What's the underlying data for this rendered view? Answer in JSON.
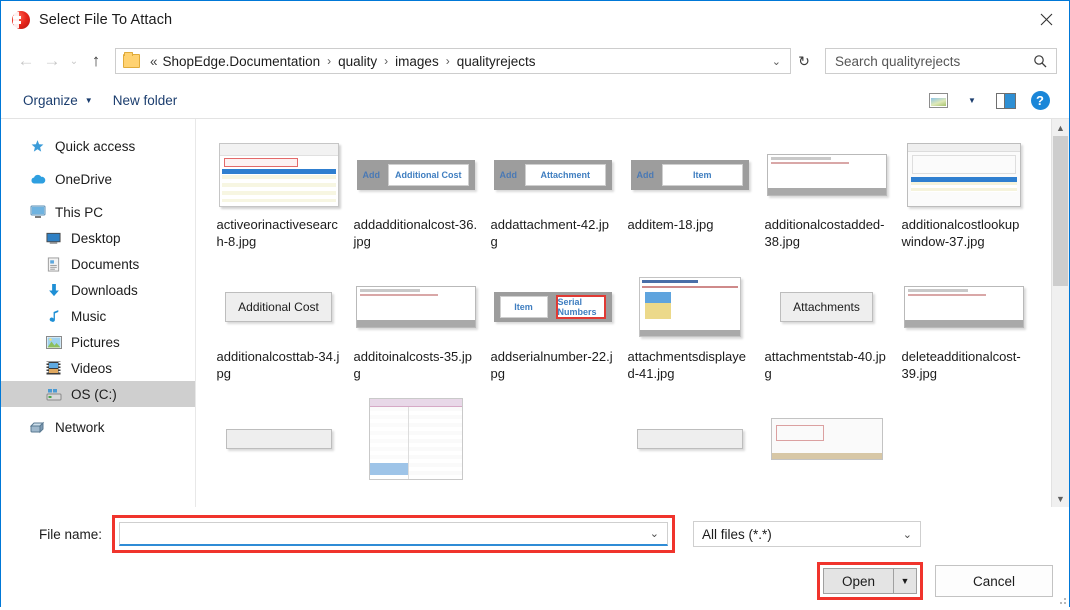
{
  "window": {
    "title": "Select File To Attach",
    "icon": "shopedge-logo-icon",
    "close_label": "✕",
    "accent": "#0078d7",
    "highlight_red": "#f0342c"
  },
  "nav": {
    "back": "←",
    "forward": "→",
    "recent": "⌄",
    "up": "↑",
    "refresh": "↻",
    "address_caret": "⌄",
    "breadcrumb_lead": "«",
    "breadcrumb": [
      "ShopEdge.Documentation",
      "quality",
      "images",
      "qualityrejects"
    ],
    "separator": "›"
  },
  "search": {
    "placeholder": "Search qualityrejects",
    "value": ""
  },
  "toolbar": {
    "organize_label": "Organize",
    "organize_caret": "▼",
    "new_folder_label": "New folder",
    "view_caret": "▼"
  },
  "sidebar": {
    "items": [
      {
        "label": "Quick access",
        "icon": "star-icon",
        "level": 0,
        "selected": false,
        "gap": false
      },
      {
        "label": "OneDrive",
        "icon": "cloud-icon",
        "level": 0,
        "selected": false,
        "gap": true
      },
      {
        "label": "This PC",
        "icon": "monitor-icon",
        "level": 0,
        "selected": false,
        "gap": true
      },
      {
        "label": "Desktop",
        "icon": "desktop-icon",
        "level": 1,
        "selected": false,
        "gap": false
      },
      {
        "label": "Documents",
        "icon": "document-icon",
        "level": 1,
        "selected": false,
        "gap": false
      },
      {
        "label": "Downloads",
        "icon": "download-icon",
        "level": 1,
        "selected": false,
        "gap": false
      },
      {
        "label": "Music",
        "icon": "music-note-icon",
        "level": 1,
        "selected": false,
        "gap": false
      },
      {
        "label": "Pictures",
        "icon": "picture-icon",
        "level": 1,
        "selected": false,
        "gap": false
      },
      {
        "label": "Videos",
        "icon": "video-icon",
        "level": 1,
        "selected": false,
        "gap": false
      },
      {
        "label": "OS (C:)",
        "icon": "drive-icon",
        "level": 1,
        "selected": true,
        "gap": false
      },
      {
        "label": "Network",
        "icon": "network-icon",
        "level": 0,
        "selected": false,
        "gap": true
      }
    ]
  },
  "files": [
    {
      "name": "activeorinactivesearch-8.jpg",
      "thumb": "screenshot-table"
    },
    {
      "name": "addadditionalcost-36.jpg",
      "thumb": "bar-add-additional-cost",
      "bar_left": "Add",
      "bar_box": "Additional Cost"
    },
    {
      "name": "addattachment-42.jpg",
      "thumb": "bar-add-attachment",
      "bar_left": "Add",
      "bar_box": "Attachment"
    },
    {
      "name": "additem-18.jpg",
      "thumb": "bar-add-item",
      "bar_left": "Add",
      "bar_box": "Item"
    },
    {
      "name": "additionalcostadded-38.jpg",
      "thumb": "window-blank"
    },
    {
      "name": "additionalcostlookupwindow-37.jpg",
      "thumb": "dialog-window"
    },
    {
      "name": "additionalcosttab-34.jpg",
      "thumb": "tab-additional-cost",
      "tab_label": "Additional Cost"
    },
    {
      "name": "additoinalcosts-35.jpg",
      "thumb": "window-blank"
    },
    {
      "name": "addserialnumber-22.jpg",
      "thumb": "bar-item-serial",
      "bar_left": "",
      "bar_box": "Item",
      "bar_box2": "Serial Numbers"
    },
    {
      "name": "attachmentsdisplayed-41.jpg",
      "thumb": "window-yellow"
    },
    {
      "name": "attachmentstab-40.jpg",
      "thumb": "tab-attachments",
      "tab_label": "Attachments"
    },
    {
      "name": "deleteadditionalcost-39.jpg",
      "thumb": "window-dialog-small"
    }
  ],
  "files_row3": [
    {
      "name": "",
      "thumb": "tab-blank"
    },
    {
      "name": "",
      "thumb": "list-window"
    },
    {
      "name": "",
      "thumb": "tab-blank"
    },
    {
      "name": "",
      "thumb": "card-window"
    }
  ],
  "footer": {
    "file_name_label": "File name:",
    "file_name_value": "",
    "file_name_caret": "⌄",
    "file_type_value": "All files (*.*)",
    "file_type_caret": "⌄",
    "open_label": "Open",
    "open_caret": "▼",
    "cancel_label": "Cancel"
  }
}
